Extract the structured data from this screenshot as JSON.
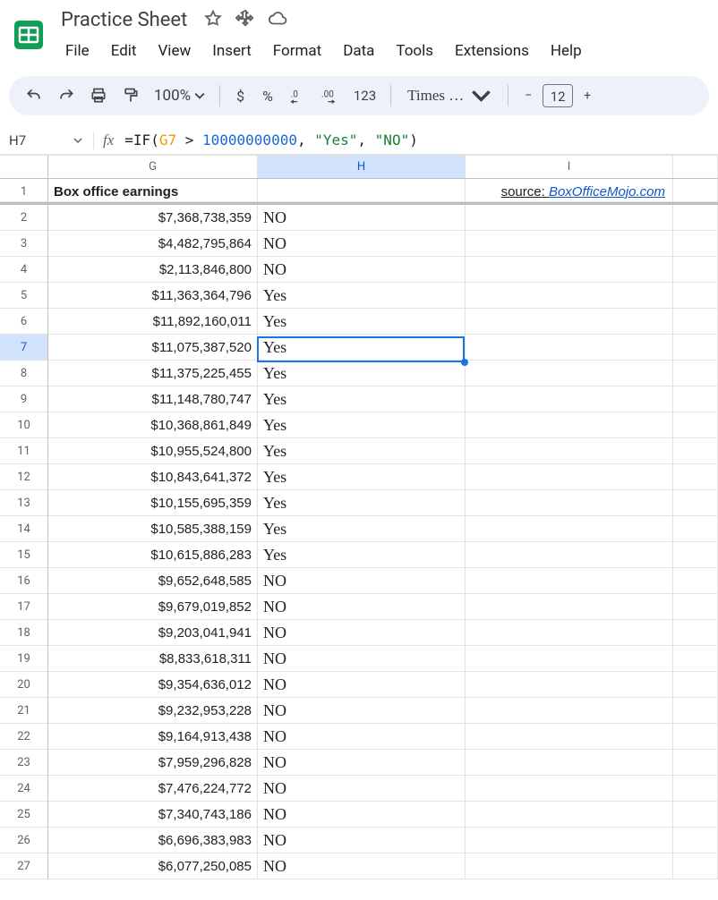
{
  "doc": {
    "title": "Practice Sheet"
  },
  "menu": {
    "file": "File",
    "edit": "Edit",
    "view": "View",
    "insert": "Insert",
    "format": "Format",
    "data": "Data",
    "tools": "Tools",
    "extensions": "Extensions",
    "help": "Help"
  },
  "toolbar": {
    "zoom": "100%",
    "currency": "$",
    "percent": "%",
    "dec_dec": ".0",
    "dec_inc": ".00",
    "onetwothree": "123",
    "font": "Times …",
    "size": "12",
    "minus": "−",
    "plus": "+"
  },
  "namebox": "H7",
  "formula": {
    "fn": "IF",
    "ref": "G7",
    "num": "10000000000",
    "str1": "\"Yes\"",
    "str2": "\"NO\""
  },
  "columns": {
    "G": "G",
    "H": "H",
    "I": "I"
  },
  "header_row": {
    "g": "Box office earnings",
    "src_label": "source: ",
    "src_link": "BoxOfficeMojo.com"
  },
  "active": {
    "row": 7,
    "col": "H"
  },
  "rows": [
    {
      "n": 2,
      "g": "$7,368,738,359",
      "h": "NO"
    },
    {
      "n": 3,
      "g": "$4,482,795,864",
      "h": "NO"
    },
    {
      "n": 4,
      "g": "$2,113,846,800",
      "h": "NO"
    },
    {
      "n": 5,
      "g": "$11,363,364,796",
      "h": "Yes"
    },
    {
      "n": 6,
      "g": "$11,892,160,011",
      "h": "Yes"
    },
    {
      "n": 7,
      "g": "$11,075,387,520",
      "h": "Yes"
    },
    {
      "n": 8,
      "g": "$11,375,225,455",
      "h": "Yes"
    },
    {
      "n": 9,
      "g": "$11,148,780,747",
      "h": "Yes"
    },
    {
      "n": 10,
      "g": "$10,368,861,849",
      "h": "Yes"
    },
    {
      "n": 11,
      "g": "$10,955,524,800",
      "h": "Yes"
    },
    {
      "n": 12,
      "g": "$10,843,641,372",
      "h": "Yes"
    },
    {
      "n": 13,
      "g": "$10,155,695,359",
      "h": "Yes"
    },
    {
      "n": 14,
      "g": "$10,585,388,159",
      "h": "Yes"
    },
    {
      "n": 15,
      "g": "$10,615,886,283",
      "h": "Yes"
    },
    {
      "n": 16,
      "g": "$9,652,648,585",
      "h": "NO"
    },
    {
      "n": 17,
      "g": "$9,679,019,852",
      "h": "NO"
    },
    {
      "n": 18,
      "g": "$9,203,041,941",
      "h": "NO"
    },
    {
      "n": 19,
      "g": "$8,833,618,311",
      "h": "NO"
    },
    {
      "n": 20,
      "g": "$9,354,636,012",
      "h": "NO"
    },
    {
      "n": 21,
      "g": "$9,232,953,228",
      "h": "NO"
    },
    {
      "n": 22,
      "g": "$9,164,913,438",
      "h": "NO"
    },
    {
      "n": 23,
      "g": "$7,959,296,828",
      "h": "NO"
    },
    {
      "n": 24,
      "g": "$7,476,224,772",
      "h": "NO"
    },
    {
      "n": 25,
      "g": "$7,340,743,186",
      "h": "NO"
    },
    {
      "n": 26,
      "g": "$6,696,383,983",
      "h": "NO"
    },
    {
      "n": 27,
      "g": "$6,077,250,085",
      "h": "NO"
    }
  ]
}
